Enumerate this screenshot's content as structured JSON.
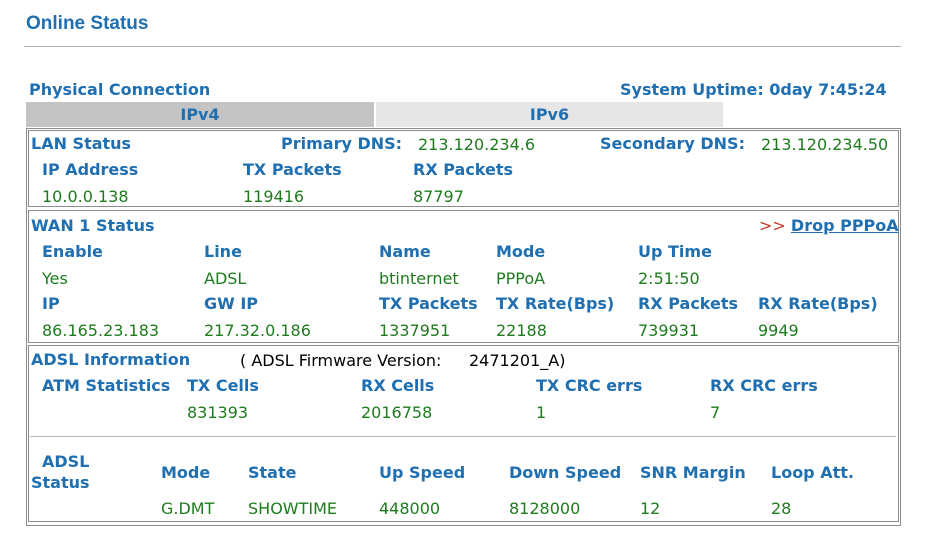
{
  "page": {
    "title": "Online Status"
  },
  "physical": {
    "heading": "Physical Connection",
    "uptime": "System Uptime: 0day 7:45:24"
  },
  "tabs": [
    {
      "label": "IPv4"
    },
    {
      "label": "IPv6"
    }
  ],
  "lan": {
    "heading": "LAN Status",
    "primary_dns_label": "Primary DNS:",
    "primary_dns": "213.120.234.6",
    "secondary_dns_label": "Secondary DNS:",
    "secondary_dns": "213.120.234.50",
    "headers": [
      "IP Address",
      "TX Packets",
      "RX Packets"
    ],
    "values": [
      "10.0.0.138",
      "119416",
      "87797"
    ]
  },
  "wan": {
    "heading": "WAN 1 Status",
    "drop_prefix": ">>",
    "drop_link": "Drop PPPoA",
    "row1_headers": [
      "Enable",
      "Line",
      "Name",
      "Mode",
      "Up Time"
    ],
    "row1_values": [
      "Yes",
      "ADSL",
      "btinternet",
      "PPPoA",
      "2:51:50"
    ],
    "row2_headers": [
      "IP",
      "GW IP",
      "TX Packets",
      "TX Rate(Bps)",
      "RX Packets",
      "RX Rate(Bps)"
    ],
    "row2_values": [
      "86.165.23.183",
      "217.32.0.186",
      "1337951",
      "22188",
      "739931",
      "9949"
    ]
  },
  "adsl": {
    "heading": "ADSL Information",
    "firmware_label": "( ADSL Firmware Version:",
    "firmware_value": "2471201_A)",
    "atm_label": "ATM Statistics",
    "atm_headers": [
      "TX Cells",
      "RX Cells",
      "TX CRC errs",
      "RX CRC errs"
    ],
    "atm_values": [
      "831393",
      "2016758",
      "1",
      "7"
    ],
    "status_label_1": "ADSL",
    "status_label_2": "Status",
    "status_headers": [
      "Mode",
      "State",
      "Up Speed",
      "Down Speed",
      "SNR Margin",
      "Loop Att."
    ],
    "status_values": [
      "G.DMT",
      "SHOWTIME",
      "448000",
      "8128000",
      "12",
      "28"
    ]
  },
  "colors": {
    "heading": "#1f6fb1",
    "value": "#1e7b1e",
    "link_prefix": "#c0392b"
  }
}
